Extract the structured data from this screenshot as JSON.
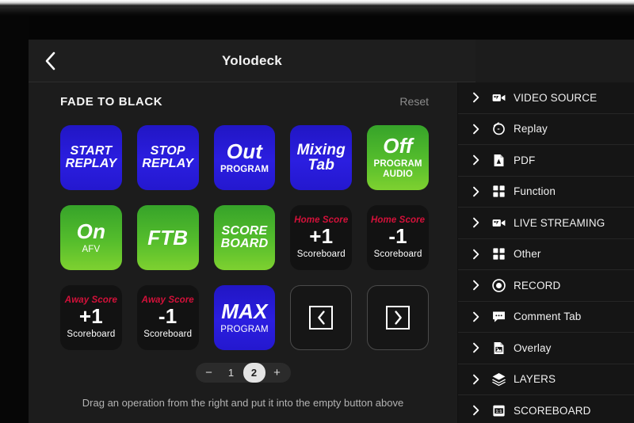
{
  "titlebar": {
    "back_icon": "chevron-left-icon",
    "title": "Yolodeck"
  },
  "deck": {
    "section_title": "FADE TO BLACK",
    "reset_label": "Reset",
    "hint": "Drag an operation from the right and put it into the empty button above",
    "pads": [
      {
        "style": "blue",
        "top": "",
        "main": "START\nREPLAY",
        "main_size": "sm",
        "sub": "",
        "name": "pad-start-replay"
      },
      {
        "style": "blue",
        "top": "",
        "main": "STOP\nREPLAY",
        "main_size": "sm",
        "sub": "",
        "name": "pad-stop-replay"
      },
      {
        "style": "blue",
        "top": "",
        "main": "Out",
        "main_size": "lg",
        "sub": "PROGRAM",
        "name": "pad-out-program"
      },
      {
        "style": "blue",
        "top": "",
        "main": "Mixing\nTab",
        "main_size": "md",
        "sub": "",
        "name": "pad-mixing-tab"
      },
      {
        "style": "green",
        "top": "",
        "main": "Off",
        "main_size": "lg",
        "sub": "PROGRAM\nAUDIO",
        "name": "pad-off-program-audio"
      },
      {
        "style": "green",
        "top": "",
        "main": "On",
        "main_size": "lg",
        "sub": "AFV",
        "sub_thin": true,
        "name": "pad-on-afv"
      },
      {
        "style": "green",
        "top": "",
        "main": "FTB",
        "main_size": "lg",
        "sub": "",
        "name": "pad-ftb"
      },
      {
        "style": "green",
        "top": "",
        "main": "SCORE\nBOARD",
        "main_size": "sm",
        "sub": "",
        "name": "pad-scoreboard"
      },
      {
        "style": "dark",
        "top": "Home Score",
        "main": "+1",
        "main_size": "lg",
        "main_upright": true,
        "sub": "Scoreboard",
        "sub_thin": true,
        "name": "pad-home-score-plus-1"
      },
      {
        "style": "dark",
        "top": "Home Score",
        "main": "-1",
        "main_size": "lg",
        "main_upright": true,
        "sub": "Scoreboard",
        "sub_thin": true,
        "name": "pad-home-score-minus-1"
      },
      {
        "style": "dark",
        "top": "Away Score",
        "main": "+1",
        "main_size": "lg",
        "main_upright": true,
        "sub": "Scoreboard",
        "sub_thin": true,
        "name": "pad-away-score-plus-1"
      },
      {
        "style": "dark",
        "top": "Away Score",
        "main": "-1",
        "main_size": "lg",
        "main_upright": true,
        "sub": "Scoreboard",
        "sub_thin": true,
        "name": "pad-away-score-minus-1"
      },
      {
        "style": "blue",
        "top": "",
        "main": "MAX",
        "main_size": "lg",
        "sub": "PROGRAM",
        "sub_thin": true,
        "name": "pad-max-program"
      },
      {
        "style": "empty",
        "icon": "chevron-left-boxed-icon",
        "name": "pad-prev-page"
      },
      {
        "style": "empty",
        "icon": "chevron-right-boxed-icon",
        "name": "pad-next-page"
      }
    ],
    "pager": {
      "minus_label": "−",
      "plus_label": "+",
      "pages": [
        "1",
        "2"
      ],
      "active_page": "2"
    }
  },
  "sidebar": {
    "items": [
      {
        "label": "VIDEO SOURCE",
        "icon": "video-camera-icon",
        "chevron": "chevron-right-icon"
      },
      {
        "label": "Replay",
        "icon": "replay-icon",
        "chevron": "chevron-right-icon"
      },
      {
        "label": "PDF",
        "icon": "pdf-file-icon",
        "chevron": "chevron-right-icon"
      },
      {
        "label": "Function",
        "icon": "grid-squares-icon",
        "chevron": "chevron-right-icon"
      },
      {
        "label": "LIVE STREAMING",
        "icon": "video-camera-icon",
        "chevron": "chevron-right-icon"
      },
      {
        "label": "Other",
        "icon": "grid-squares-icon",
        "chevron": "chevron-right-icon"
      },
      {
        "label": "RECORD",
        "icon": "record-dot-icon",
        "chevron": "chevron-right-icon"
      },
      {
        "label": "Comment Tab",
        "icon": "comment-bubble-icon",
        "chevron": "chevron-right-icon"
      },
      {
        "label": "Overlay",
        "icon": "image-file-icon",
        "chevron": "chevron-right-icon"
      },
      {
        "label": "LAYERS",
        "icon": "layers-icon",
        "chevron": "chevron-right-icon"
      },
      {
        "label": "SCOREBOARD",
        "icon": "scoreboard-icon",
        "chevron": "chevron-right-icon"
      }
    ]
  },
  "colors": {
    "pad_blue": "#2b1ee0",
    "pad_green_top": "#36a32a",
    "pad_green_bottom": "#7ed130",
    "score_red": "#d4113a",
    "panel_bg": "#1c1c1c",
    "sidebar_bg": "#151515"
  }
}
